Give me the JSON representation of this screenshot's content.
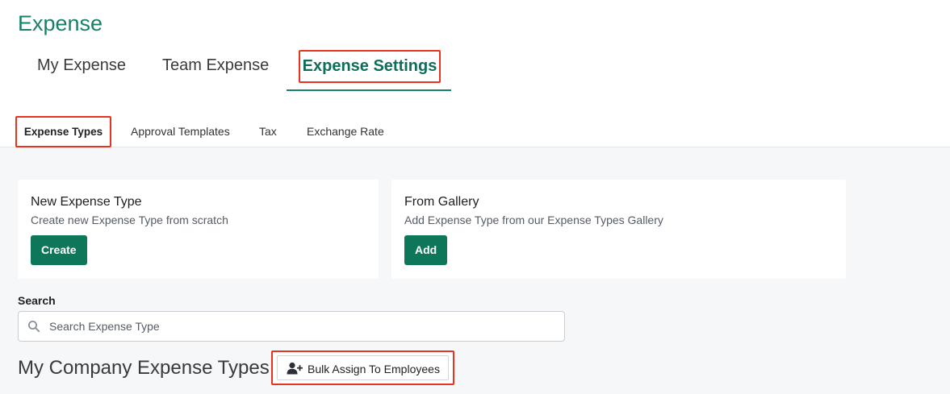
{
  "app": {
    "title": "Expense"
  },
  "main_tabs": [
    {
      "label": "My Expense"
    },
    {
      "label": "Team Expense"
    },
    {
      "label": "Expense Settings",
      "active": true
    }
  ],
  "sub_tabs": [
    {
      "label": "Expense Types",
      "active": true
    },
    {
      "label": "Approval Templates"
    },
    {
      "label": "Tax"
    },
    {
      "label": "Exchange Rate"
    }
  ],
  "cards": {
    "new_type": {
      "title": "New Expense Type",
      "subtitle": "Create new Expense Type from scratch",
      "button": "Create"
    },
    "gallery": {
      "title": "From Gallery",
      "subtitle": "Add Expense Type from our Expense Types Gallery",
      "button": "Add"
    }
  },
  "search": {
    "label": "Search",
    "placeholder": "Search Expense Type",
    "value": ""
  },
  "section": {
    "title": "My Company Expense Types",
    "bulk_button": "Bulk Assign To Employees"
  },
  "colors": {
    "brand": "#17806b",
    "primary_button": "#0f7759",
    "highlight": "#e8331f",
    "content_bg": "#f6f7f9"
  },
  "icons": {
    "search": "search-icon",
    "bulk": "user-plus-icon"
  }
}
